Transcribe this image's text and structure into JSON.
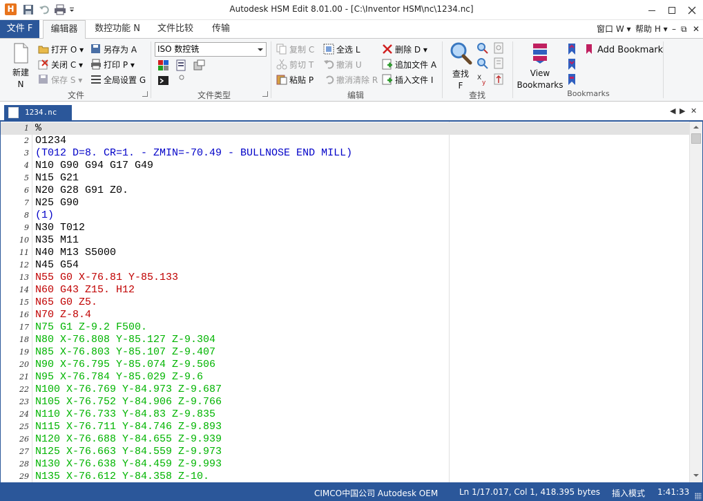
{
  "window": {
    "title": "Autodesk HSM Edit 8.01.00 - [C:\\Inventor HSM\\nc\\1234.nc]",
    "app_icon": "H"
  },
  "ribbon_tabs": {
    "file": "文件 F",
    "items": [
      "编辑器",
      "数控功能 N",
      "文件比较",
      "传输"
    ],
    "active": 0,
    "window_menu": "窗口 W",
    "help_menu": "帮助 H"
  },
  "groups": {
    "file": {
      "label": "文件",
      "new": "新建\nN",
      "open": "打开 O",
      "save_as": "另存为 A",
      "close": "关闭 C",
      "print": "打印 P",
      "save": "保存 S",
      "global_settings": "全局设置 G"
    },
    "filetype": {
      "label": "文件类型",
      "combo_value": "ISO 数控铣"
    },
    "edit": {
      "label": "编辑",
      "copy": "复制 C",
      "cut": "剪切 T",
      "paste": "粘贴 P",
      "select_all": "全选 L",
      "undo": "撤消 U",
      "undo_clear": "撤消清除 R",
      "delete": "删除 D",
      "append_file": "追加文件 A",
      "insert_file": "插入文件 I"
    },
    "find": {
      "label": "查找",
      "find": "查找\nF"
    },
    "bookmarks": {
      "label": "Bookmarks",
      "view": "View\nBookmarks",
      "add": "Add Bookmark"
    }
  },
  "document": {
    "tab_name": "1234.nc"
  },
  "editor": {
    "lines": [
      {
        "n": "1",
        "text": "%",
        "color": "#000000"
      },
      {
        "n": "2",
        "text": "O1234",
        "color": "#000000"
      },
      {
        "n": "3",
        "text": "(T012 D=8. CR=1. - ZMIN=-70.49 - BULLNOSE END MILL)",
        "color": "#0000c8"
      },
      {
        "n": "4",
        "text": "N10 G90 G94 G17 G49",
        "color": "#000000"
      },
      {
        "n": "5",
        "text": "N15 G21",
        "color": "#000000"
      },
      {
        "n": "6",
        "text": "N20 G28 G91 Z0.",
        "color": "#000000"
      },
      {
        "n": "7",
        "text": "N25 G90",
        "color": "#000000"
      },
      {
        "n": "8",
        "text": "(1)",
        "color": "#0000c8"
      },
      {
        "n": "9",
        "text": "N30 T012",
        "color": "#000000"
      },
      {
        "n": "10",
        "text": "N35 M11",
        "color": "#000000"
      },
      {
        "n": "11",
        "text": "N40 M13 S5000",
        "color": "#000000"
      },
      {
        "n": "12",
        "text": "N45 G54",
        "color": "#000000"
      },
      {
        "n": "13",
        "text": "N55 G0 X-76.81 Y-85.133",
        "color": "#c00000"
      },
      {
        "n": "14",
        "text": "N60 G43 Z15. H12",
        "color": "#c00000"
      },
      {
        "n": "15",
        "text": "N65 G0 Z5.",
        "color": "#c00000"
      },
      {
        "n": "16",
        "text": "N70 Z-8.4",
        "color": "#c00000"
      },
      {
        "n": "17",
        "text": "N75 G1 Z-9.2 F500.",
        "color": "#00b400"
      },
      {
        "n": "18",
        "text": "N80 X-76.808 Y-85.127 Z-9.304",
        "color": "#00b400"
      },
      {
        "n": "19",
        "text": "N85 X-76.803 Y-85.107 Z-9.407",
        "color": "#00b400"
      },
      {
        "n": "20",
        "text": "N90 X-76.795 Y-85.074 Z-9.506",
        "color": "#00b400"
      },
      {
        "n": "21",
        "text": "N95 X-76.784 Y-85.029 Z-9.6",
        "color": "#00b400"
      },
      {
        "n": "22",
        "text": "N100 X-76.769 Y-84.973 Z-9.687",
        "color": "#00b400"
      },
      {
        "n": "23",
        "text": "N105 X-76.752 Y-84.906 Z-9.766",
        "color": "#00b400"
      },
      {
        "n": "24",
        "text": "N110 X-76.733 Y-84.83 Z-9.835",
        "color": "#00b400"
      },
      {
        "n": "25",
        "text": "N115 X-76.711 Y-84.746 Z-9.893",
        "color": "#00b400"
      },
      {
        "n": "26",
        "text": "N120 X-76.688 Y-84.655 Z-9.939",
        "color": "#00b400"
      },
      {
        "n": "27",
        "text": "N125 X-76.663 Y-84.559 Z-9.973",
        "color": "#00b400"
      },
      {
        "n": "28",
        "text": "N130 X-76.638 Y-84.459 Z-9.993",
        "color": "#00b400"
      },
      {
        "n": "29",
        "text": "N135 X-76.612 Y-84.358 Z-10.",
        "color": "#00b400"
      }
    ]
  },
  "status": {
    "company": "CIMCO中国公司 Autodesk OEM",
    "position": "Ln 1/17.017, Col 1, 418.395 bytes",
    "mode": "插入模式",
    "time": "1:41:33"
  },
  "colors": {
    "accent": "#2b579a",
    "comment": "#0000c8",
    "rapid": "#c00000",
    "feed": "#00b400"
  }
}
